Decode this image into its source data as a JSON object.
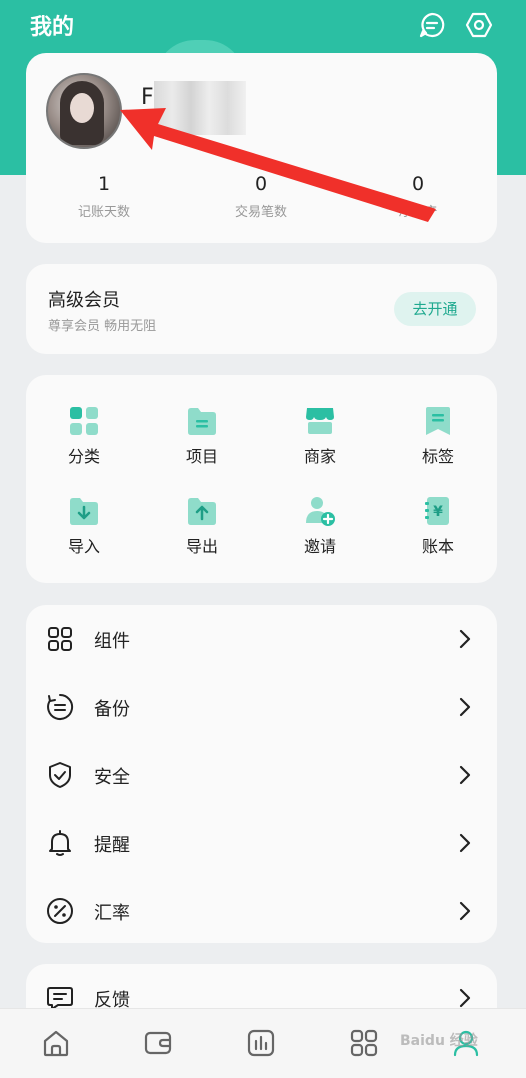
{
  "header": {
    "title": "我的",
    "icons": [
      "message-icon",
      "settings-icon"
    ]
  },
  "profile": {
    "name_visible": "F",
    "stats": [
      {
        "value": "1",
        "label": "记账天数"
      },
      {
        "value": "0",
        "label": "交易笔数"
      },
      {
        "value": "0",
        "label": "净资产"
      }
    ]
  },
  "vip": {
    "title": "高级会员",
    "subtitle": "尊享会员 畅用无阻",
    "button": "去开通"
  },
  "grid": {
    "items": [
      {
        "label": "分类",
        "icon": "category-icon"
      },
      {
        "label": "项目",
        "icon": "project-icon"
      },
      {
        "label": "商家",
        "icon": "merchant-icon"
      },
      {
        "label": "标签",
        "icon": "tag-icon"
      },
      {
        "label": "导入",
        "icon": "import-icon"
      },
      {
        "label": "导出",
        "icon": "export-icon"
      },
      {
        "label": "邀请",
        "icon": "invite-icon"
      },
      {
        "label": "账本",
        "icon": "ledger-icon"
      }
    ]
  },
  "menu": {
    "items": [
      {
        "label": "组件",
        "icon": "widgets-icon"
      },
      {
        "label": "备份",
        "icon": "backup-icon"
      },
      {
        "label": "安全",
        "icon": "shield-icon"
      },
      {
        "label": "提醒",
        "icon": "bell-icon"
      },
      {
        "label": "汇率",
        "icon": "percent-icon"
      }
    ],
    "extra": [
      {
        "label": "反馈",
        "icon": "feedback-icon"
      }
    ]
  },
  "bottom_nav": {
    "items": [
      "home-icon",
      "wallet-icon",
      "chart-icon",
      "apps-icon",
      "profile-icon"
    ]
  },
  "watermark": "Baidu 经验",
  "colors": {
    "accent": "#2bbfa3",
    "accent_light": "#dff3ef",
    "arrow": "#f0302a"
  }
}
